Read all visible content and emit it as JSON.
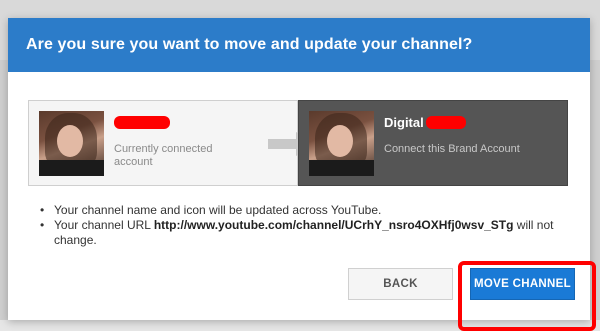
{
  "dialog": {
    "title": "Are you sure you want to move and update your channel?"
  },
  "current_account": {
    "name_redacted": true,
    "subtitle": "Currently connected account"
  },
  "brand_account": {
    "name": "Digital",
    "name_suffix_redacted": true,
    "subtitle": "Connect this Brand Account"
  },
  "notes": {
    "item1": "Your channel name and icon will be updated across YouTube.",
    "item2_prefix": "Your channel URL ",
    "item2_url": "http://www.youtube.com/channel/UCrhY_nsro4OXHfj0wsv_STg",
    "item2_suffix": " will not change."
  },
  "actions": {
    "back_label": "BACK",
    "move_label": "MOVE CHANNEL"
  },
  "colors": {
    "header": "#2c7cc9",
    "primary_button": "#1a7ad6",
    "brand_card": "#555555",
    "annotation": "#ff0000"
  },
  "icons": {
    "arrow": "arrow-right-icon",
    "avatar": "avatar"
  }
}
